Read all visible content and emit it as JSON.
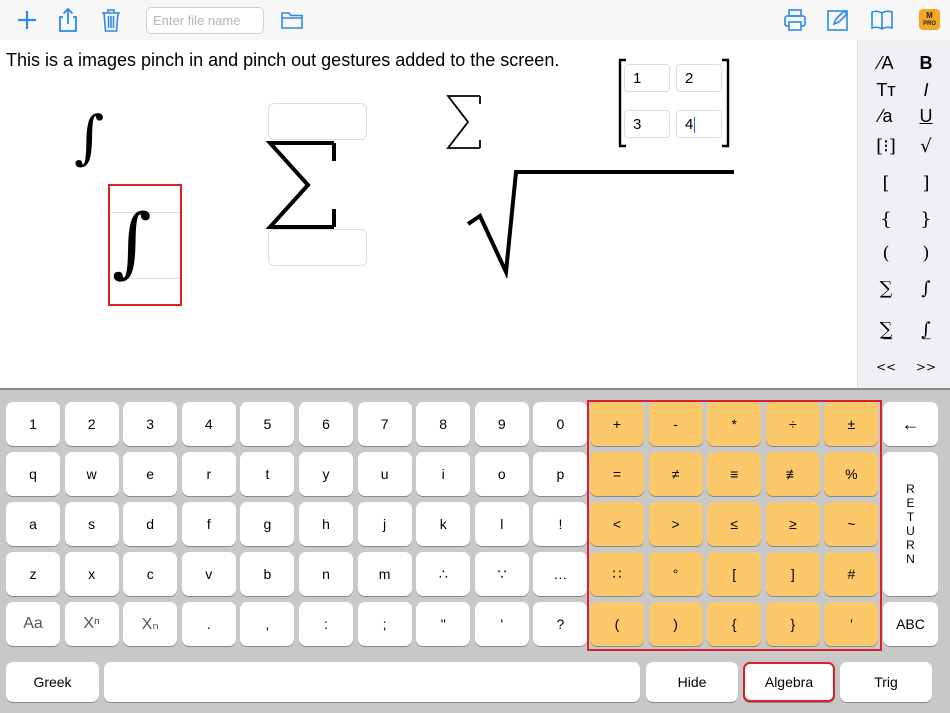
{
  "toolbar": {
    "filename_placeholder": "Enter file name",
    "pro_badge_top": "M",
    "pro_badge_bottom": "PRO",
    "accent": "#2a8ae8",
    "icons_left": [
      "plus-icon",
      "share-icon",
      "trash-icon",
      "folder-icon"
    ],
    "icons_right": [
      "print-icon",
      "edit-icon",
      "book-icon"
    ]
  },
  "editor": {
    "text": "This is a images pinch in and pinch out gestures added to the screen.",
    "matrix": {
      "cells": [
        "1",
        "2",
        "3",
        "4"
      ]
    },
    "symbols": {
      "integral": "∫",
      "sigma": "∑",
      "sqrt": "√"
    }
  },
  "palette": {
    "items": [
      [
        "⁄A",
        "B"
      ],
      [
        "Tт",
        "I"
      ],
      [
        "⁄a",
        "U"
      ],
      [
        "[⁝]",
        "√"
      ],
      [
        "[",
        "]"
      ],
      [
        "{",
        "}"
      ],
      [
        "(",
        ")"
      ],
      [
        "∑",
        "∫"
      ],
      [
        "∑̲",
        "∫̲"
      ],
      [
        "<<",
        ">>"
      ]
    ]
  },
  "keyboard": {
    "rows": [
      [
        "1",
        "2",
        "3",
        "4",
        "5",
        "6",
        "7",
        "8",
        "9",
        "0"
      ],
      [
        "q",
        "w",
        "e",
        "r",
        "t",
        "y",
        "u",
        "i",
        "o",
        "p"
      ],
      [
        "a",
        "s",
        "d",
        "f",
        "g",
        "h",
        "j",
        "k",
        "l",
        "!"
      ],
      [
        "z",
        "x",
        "c",
        "v",
        "b",
        "n",
        "m",
        "∴",
        "∵",
        "…"
      ],
      [
        "Aa",
        "Xⁿ",
        "Xₙ",
        ".",
        ",",
        ":",
        ";",
        "\"",
        "'",
        "?"
      ]
    ],
    "algebra_rows": [
      [
        "+",
        "-",
        "*",
        "÷",
        "±"
      ],
      [
        "=",
        "≠",
        "≡",
        "≢",
        "%"
      ],
      [
        "<",
        ">",
        "≤",
        "≥",
        "~"
      ],
      [
        "∷",
        "°",
        "[",
        "]",
        "#"
      ],
      [
        "(",
        ")",
        "{",
        "}",
        "′"
      ]
    ],
    "backspace": "←",
    "return_letters": [
      "R",
      "E",
      "T",
      "U",
      "R",
      "N"
    ],
    "abc": "ABC",
    "bottom": {
      "greek": "Greek",
      "hide": "Hide",
      "algebra": "Algebra",
      "trig": "Trig"
    },
    "colors": {
      "algebra_key": "#fcc96a",
      "selected_border": "#d9202a"
    }
  }
}
